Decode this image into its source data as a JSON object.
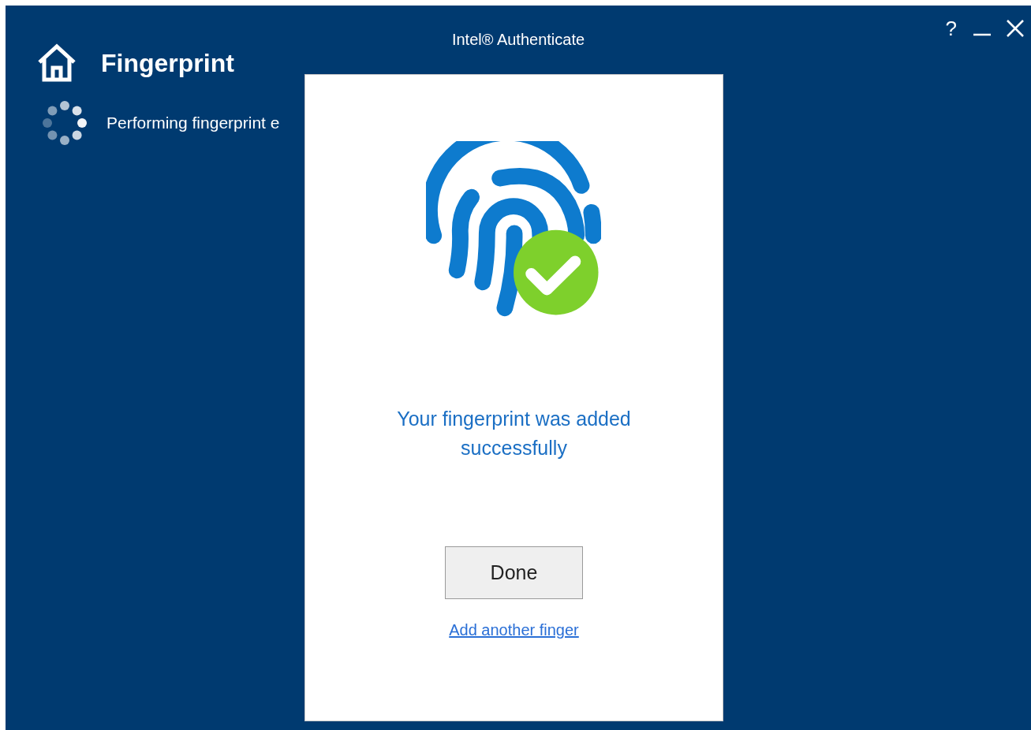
{
  "window": {
    "title": "Intel® Authenticate",
    "help": "?"
  },
  "header": {
    "title": "Fingerprint"
  },
  "status": {
    "text": "Performing fingerprint e"
  },
  "dialog": {
    "message": "Your fingerprint was added successfully",
    "button": "Done",
    "link": "Add another finger"
  }
}
